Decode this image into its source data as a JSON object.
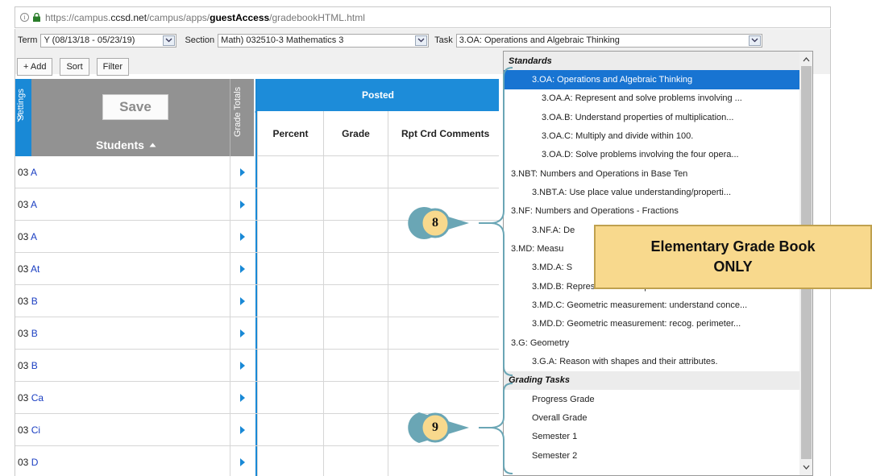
{
  "browser": {
    "url_prefix": "https://campus.",
    "url_domain": "ccsd.net",
    "url_path1": "/campus/apps/",
    "url_bold": "guestAccess",
    "url_path2": "/gradebookHTML.html"
  },
  "toolbar": {
    "term_label": "Term",
    "term_value": "Y (08/13/18 - 05/23/19)",
    "section_label": "Section",
    "section_value": "Math) 032510-3 Mathematics 3",
    "task_label": "Task",
    "task_value": "3.OA: Operations and Algebraic Thinking",
    "add_label": "+ Add",
    "sort_label": "Sort",
    "filter_label": "Filter"
  },
  "grid": {
    "settings_label": "Settings",
    "save_label": "Save",
    "students_label": "Students",
    "grade_totals_label": "Grade Totals",
    "posted_label": "Posted",
    "columns": [
      "Percent",
      "Grade",
      "Rpt Crd Comments"
    ],
    "rows": [
      {
        "prefix": "03",
        "name": "A"
      },
      {
        "prefix": "03",
        "name": "A"
      },
      {
        "prefix": "03",
        "name": "A"
      },
      {
        "prefix": "03",
        "name": "At"
      },
      {
        "prefix": "03",
        "name": "B"
      },
      {
        "prefix": "03",
        "name": "B"
      },
      {
        "prefix": "03",
        "name": "B"
      },
      {
        "prefix": "03",
        "name": "Ca"
      },
      {
        "prefix": "03",
        "name": "Ci"
      },
      {
        "prefix": "03",
        "name": "D"
      }
    ]
  },
  "dropdown": {
    "items": [
      {
        "text": "Standards",
        "kind": "group"
      },
      {
        "text": "3.OA: Operations and Algebraic Thinking",
        "kind": "l1c",
        "selected": true
      },
      {
        "text": "3.OA.A: Represent and solve problems involving ...",
        "kind": "l2"
      },
      {
        "text": "3.OA.B: Understand properties of multiplication...",
        "kind": "l2"
      },
      {
        "text": "3.OA.C: Multiply and divide within 100.",
        "kind": "l2"
      },
      {
        "text": "3.OA.D: Solve problems involving the four opera...",
        "kind": "l2"
      },
      {
        "text": "3.NBT: Numbers and Operations in Base Ten",
        "kind": "l1"
      },
      {
        "text": "3.NBT.A: Use place value understanding/properti...",
        "kind": "l1c"
      },
      {
        "text": "3.NF: Numbers and Operations - Fractions",
        "kind": "l1"
      },
      {
        "text": "3.NF.A: De",
        "kind": "l1c"
      },
      {
        "text": "3.MD: Measu",
        "kind": "l1"
      },
      {
        "text": "3.MD.A: S",
        "kind": "l1c"
      },
      {
        "text": "3.MD.B: Represent and interpret data.",
        "kind": "l1c"
      },
      {
        "text": "3.MD.C: Geometric measurement: understand conce...",
        "kind": "l1c"
      },
      {
        "text": "3.MD.D: Geometric measurement: recog. perimeter...",
        "kind": "l1c"
      },
      {
        "text": "3.G: Geometry",
        "kind": "l1"
      },
      {
        "text": "3.G.A: Reason with shapes and their attributes.",
        "kind": "l1c"
      },
      {
        "text": "Grading Tasks",
        "kind": "group"
      },
      {
        "text": "Progress Grade",
        "kind": "gt"
      },
      {
        "text": "Overall Grade",
        "kind": "gt"
      },
      {
        "text": "Semester 1",
        "kind": "gt"
      },
      {
        "text": "Semester 2",
        "kind": "gt"
      }
    ]
  },
  "callouts": {
    "badge_8": "8",
    "badge_9": "9",
    "note_line1": "Elementary Grade Book",
    "note_line2": "ONLY"
  },
  "colors": {
    "accent_blue": "#1989d6",
    "selected_blue": "#1874d2",
    "header_gray": "#929292",
    "callout_fill": "#f8d98d",
    "bracket_teal": "#6aa6b5"
  }
}
